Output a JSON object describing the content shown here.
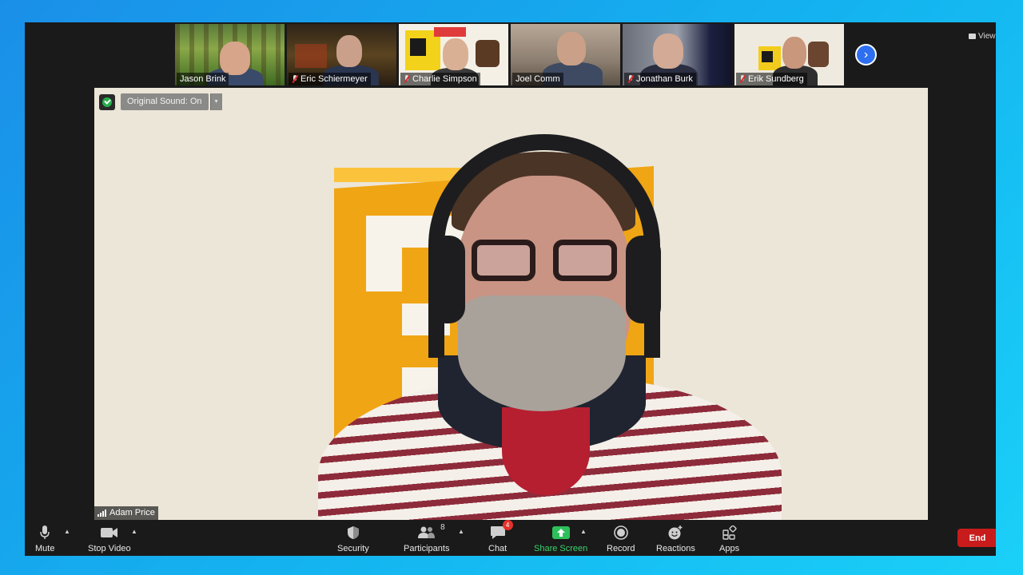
{
  "window": {
    "view_label": "View"
  },
  "participants_strip": [
    {
      "name": "Jason Brink",
      "muted": false
    },
    {
      "name": "Eric Schiermeyer",
      "muted": true
    },
    {
      "name": "Charlie Simpson",
      "muted": true
    },
    {
      "name": "Joel Comm",
      "muted": false
    },
    {
      "name": "Jonathan Burk",
      "muted": true
    },
    {
      "name": "Erik Sundberg",
      "muted": true
    }
  ],
  "main_video": {
    "original_sound_label": "Original Sound: On",
    "speaker_name": "Adam Price"
  },
  "toolbar": {
    "mute_label": "Mute",
    "stop_video_label": "Stop Video",
    "security_label": "Security",
    "participants_label": "Participants",
    "participants_count": "8",
    "chat_label": "Chat",
    "chat_badge": "4",
    "share_screen_label": "Share Screen",
    "record_label": "Record",
    "reactions_label": "Reactions",
    "apps_label": "Apps",
    "end_label": "End"
  },
  "colors": {
    "share_green": "#3ad26a",
    "end_red": "#c81c1c",
    "shield_green": "#26b04a",
    "next_blue": "#2d6ff0"
  }
}
